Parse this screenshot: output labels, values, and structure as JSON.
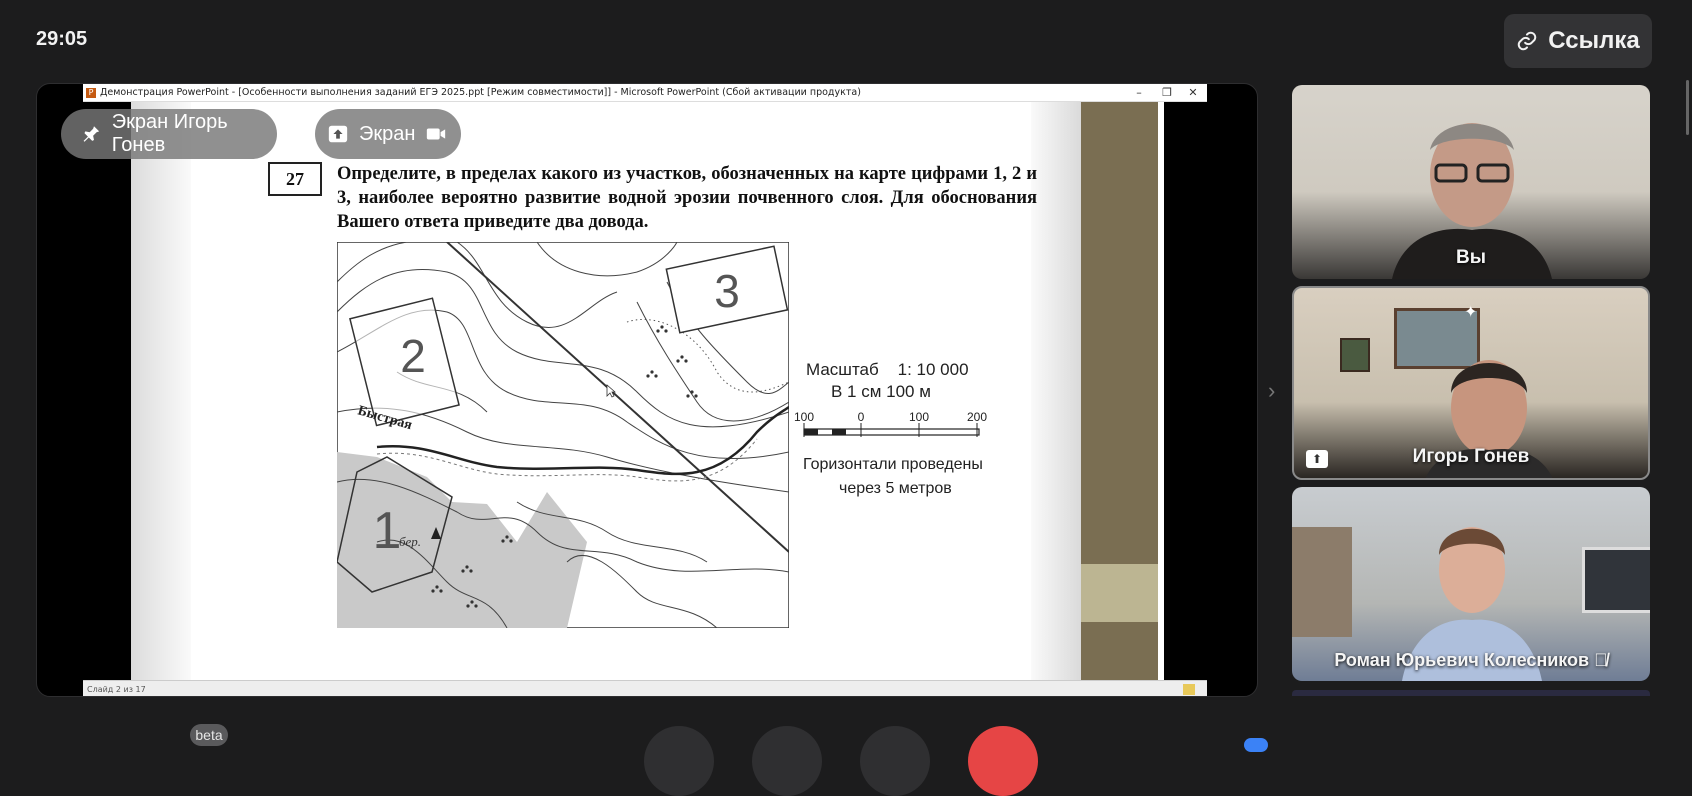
{
  "timer": "29:05",
  "link_button": {
    "label": "Ссылка",
    "icon": "link-icon"
  },
  "screen_share": {
    "window_title": "Демонстрация PowerPoint - [Особенности выполнения заданий ЕГЭ 2025.ppt [Режим совместимости]] - Microsoft PowerPoint (Сбой активации продукта)",
    "window_controls": [
      "–",
      "❐",
      "✕"
    ],
    "question_number": "27",
    "question_text": "Определите, в пределах какого из участков, обозначенных на карте цифрами 1, 2 и 3, наиболее вероятно развитие водной эрозии почвенного слоя. Для обоснования Вашего ответа приведите два довода.",
    "map": {
      "area_labels": [
        "1",
        "2",
        "3"
      ],
      "river_label": "Быстрая",
      "site_label": "бер.",
      "scale_title": "Масштаб    1: 10 000",
      "scale_subtitle": "В 1 см 100 м",
      "scale_ticks": [
        "100",
        "0",
        "100",
        "200"
      ],
      "contour_note_line1": "Горизонтали проведены",
      "contour_note_line2": "через 5 метров"
    },
    "status_bar": "Слайд 2 из 17"
  },
  "pills": {
    "pinned_screen": {
      "label": "Экран Игорь Гонев",
      "icon": "pin-icon"
    },
    "screen": {
      "label": "Экран",
      "share_icon": "share-screen-icon",
      "camera_icon": "camera-icon"
    }
  },
  "participants": [
    {
      "name": "Вы"
    },
    {
      "name": "Игорь Гонев",
      "pinned": true,
      "sharing": true
    },
    {
      "name": "Роман Юрьевич Колесников",
      "muted": true
    }
  ],
  "beta_label": "beta",
  "colors": {
    "background": "#1c1c1d",
    "end_call": "#e64545",
    "olive": "#7a6e52"
  }
}
